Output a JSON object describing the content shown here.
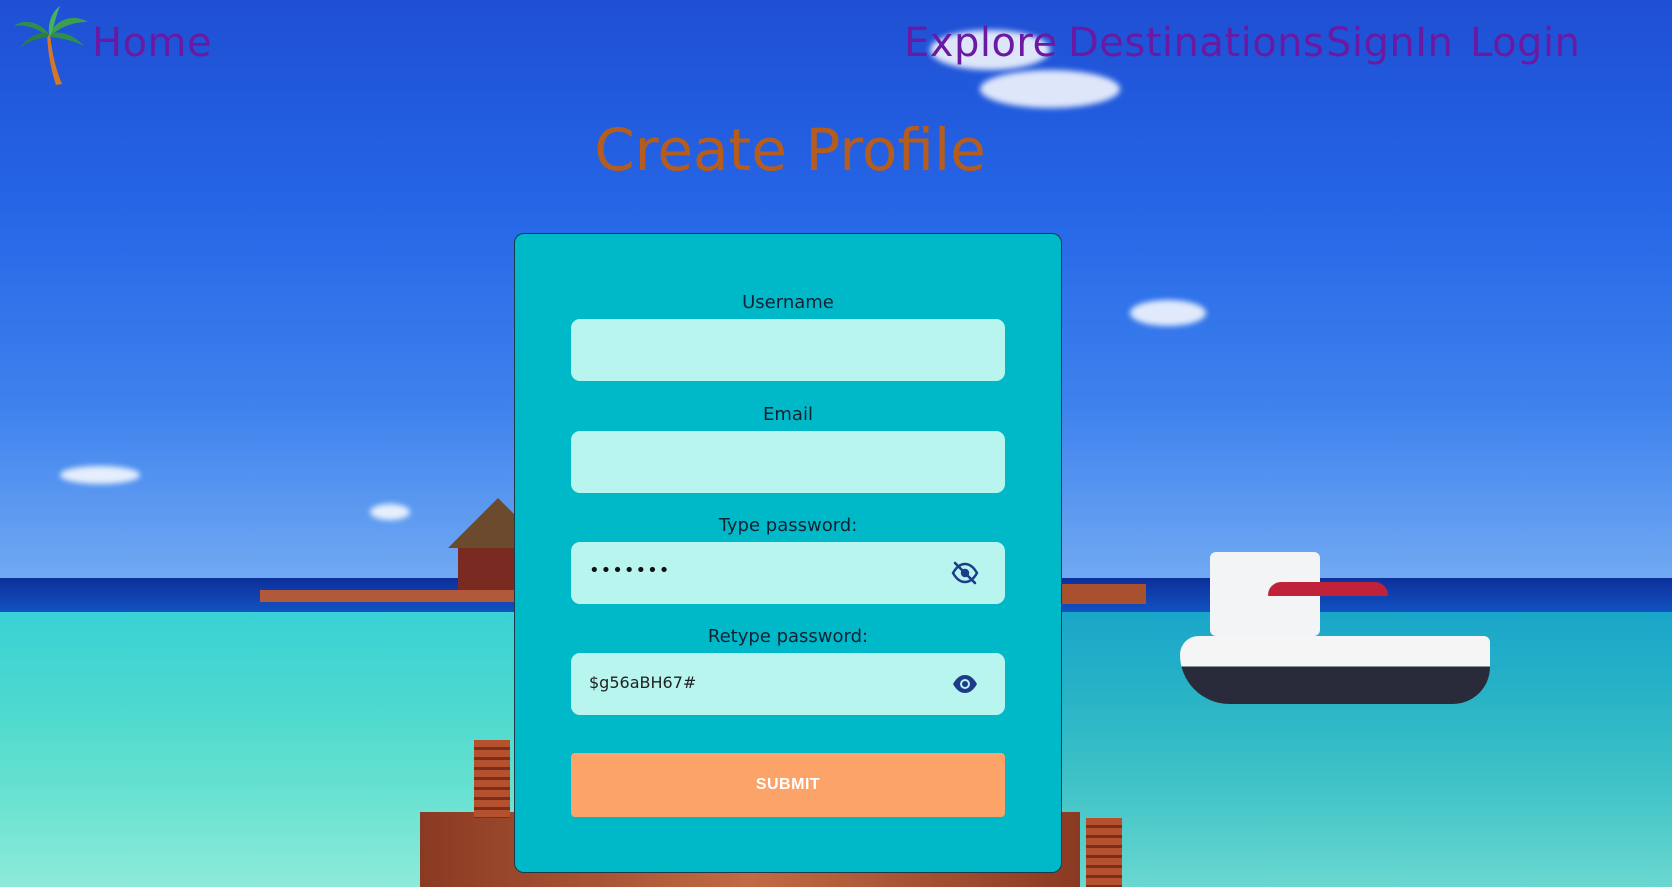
{
  "nav": {
    "home": "Home",
    "links": [
      "Explore",
      "Destinations",
      "SignIn",
      "Login"
    ]
  },
  "page": {
    "title": "Create Profile"
  },
  "form": {
    "username": {
      "label": "Username",
      "value": ""
    },
    "email": {
      "label": "Email",
      "value": ""
    },
    "password": {
      "label": "Type password:",
      "masked_value": "•••••••"
    },
    "retype_password": {
      "label": "Retype password:",
      "value": "$g56aBH67#"
    },
    "submit_label": "SUBMIT"
  },
  "colors": {
    "nav_link": "#6a1aa2",
    "title": "#b65d1e",
    "card": "#00b9c8",
    "input": "#b8f5ee",
    "submit": "#fca36a",
    "eye_icon": "#1e3a8a"
  },
  "icons": [
    "palm-tree-icon",
    "eye-slash-icon",
    "eye-icon"
  ]
}
